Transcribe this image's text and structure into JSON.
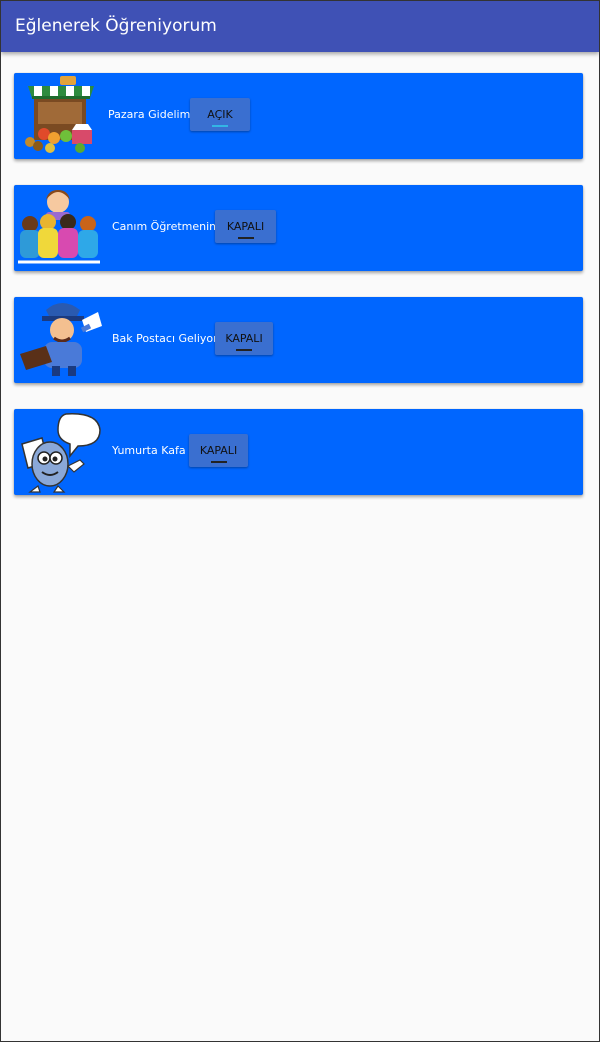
{
  "app": {
    "title": "Eğlenerek Öğreniyorum"
  },
  "colors": {
    "appbar": "#3f51b5",
    "card": "#0066ff",
    "toggle_on_indicator": "#33b5e5",
    "toggle_off_indicator": "#222222"
  },
  "items": [
    {
      "label": "Pazara Gidelim",
      "toggle": "AÇIK",
      "on": true,
      "icon": "market-stall-icon"
    },
    {
      "label": "Canım Öğretmenim",
      "toggle": "KAPALI",
      "on": false,
      "icon": "teacher-children-icon"
    },
    {
      "label": "Bak Postacı Geliyor",
      "toggle": "KAPALI",
      "on": false,
      "icon": "postman-icon"
    },
    {
      "label": "Yumurta Kafa",
      "toggle": "KAPALI",
      "on": false,
      "icon": "egg-head-icon"
    }
  ]
}
